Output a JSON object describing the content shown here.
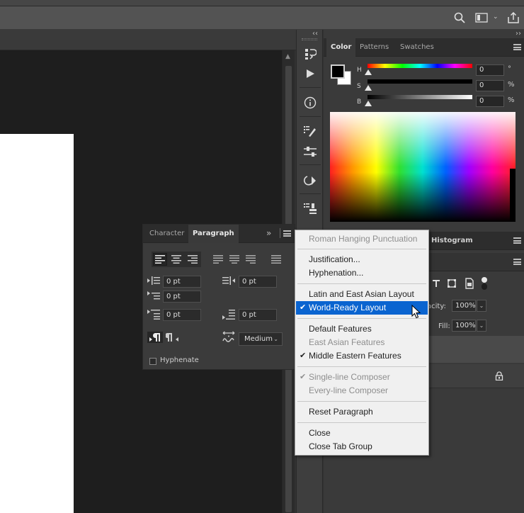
{
  "options_bar": {
    "icons": [
      "search-icon",
      "workspace-icon",
      "chevron-down-icon",
      "share-icon"
    ]
  },
  "icon_strip": {
    "collapse": "‹‹",
    "buttons": [
      "history-icon",
      "actions-play-icon",
      "info-icon",
      "brush-settings-icon",
      "adjust-sliders-icon",
      "clone-source-icon",
      "tool-presets-icon"
    ]
  },
  "color_panel": {
    "collapse": "››",
    "tabs": [
      "Color",
      "Patterns",
      "Swatches"
    ],
    "active_tab": "Color",
    "sliders": [
      {
        "label": "H",
        "value": "0",
        "unit": "°"
      },
      {
        "label": "S",
        "value": "0",
        "unit": "%"
      },
      {
        "label": "B",
        "value": "0",
        "unit": "%"
      }
    ],
    "foreground": "#000000",
    "background": "#ffffff"
  },
  "layers_panel": {
    "tab_fragment": "Histogram",
    "opacity_label": "acity:",
    "opacity_value": "100%",
    "fill_label": "Fill:",
    "fill_value": "100%"
  },
  "paragraph_panel": {
    "tabs": [
      "Character",
      "Paragraph"
    ],
    "active_tab": "Paragraph",
    "expand": "»",
    "indent_left": "0 pt",
    "indent_right": "0 pt",
    "indent_first": "0 pt",
    "space_before": "0 pt",
    "space_after": "0 pt",
    "kashida": "Medium",
    "hyphenate_label": "Hyphenate",
    "hyphenate_checked": false
  },
  "menu": {
    "items": [
      {
        "label": "Roman Hanging Punctuation",
        "disabled": true,
        "checked": false
      },
      {
        "label": "Justification...",
        "disabled": false,
        "checked": false
      },
      {
        "label": "Hyphenation...",
        "disabled": false,
        "checked": false
      },
      {
        "label": "Latin and East Asian Layout",
        "disabled": false,
        "checked": false
      },
      {
        "label": "World-Ready Layout",
        "disabled": false,
        "checked": true,
        "highlighted": true
      },
      {
        "label": "Default Features",
        "disabled": false,
        "checked": false
      },
      {
        "label": "East Asian Features",
        "disabled": true,
        "checked": false
      },
      {
        "label": "Middle Eastern Features",
        "disabled": false,
        "checked": true
      },
      {
        "label": "Single-line Composer",
        "disabled": true,
        "checked": true
      },
      {
        "label": "Every-line Composer",
        "disabled": true,
        "checked": false
      },
      {
        "label": "Reset Paragraph",
        "disabled": false,
        "checked": false
      },
      {
        "label": "Close",
        "disabled": false,
        "checked": false
      },
      {
        "label": "Close Tab Group",
        "disabled": false,
        "checked": false
      }
    ],
    "check_glyph": "✔"
  },
  "colors": {
    "highlight": "#0a64d0",
    "canvas": "#1e1e1e",
    "panel": "#3a3a3a"
  }
}
